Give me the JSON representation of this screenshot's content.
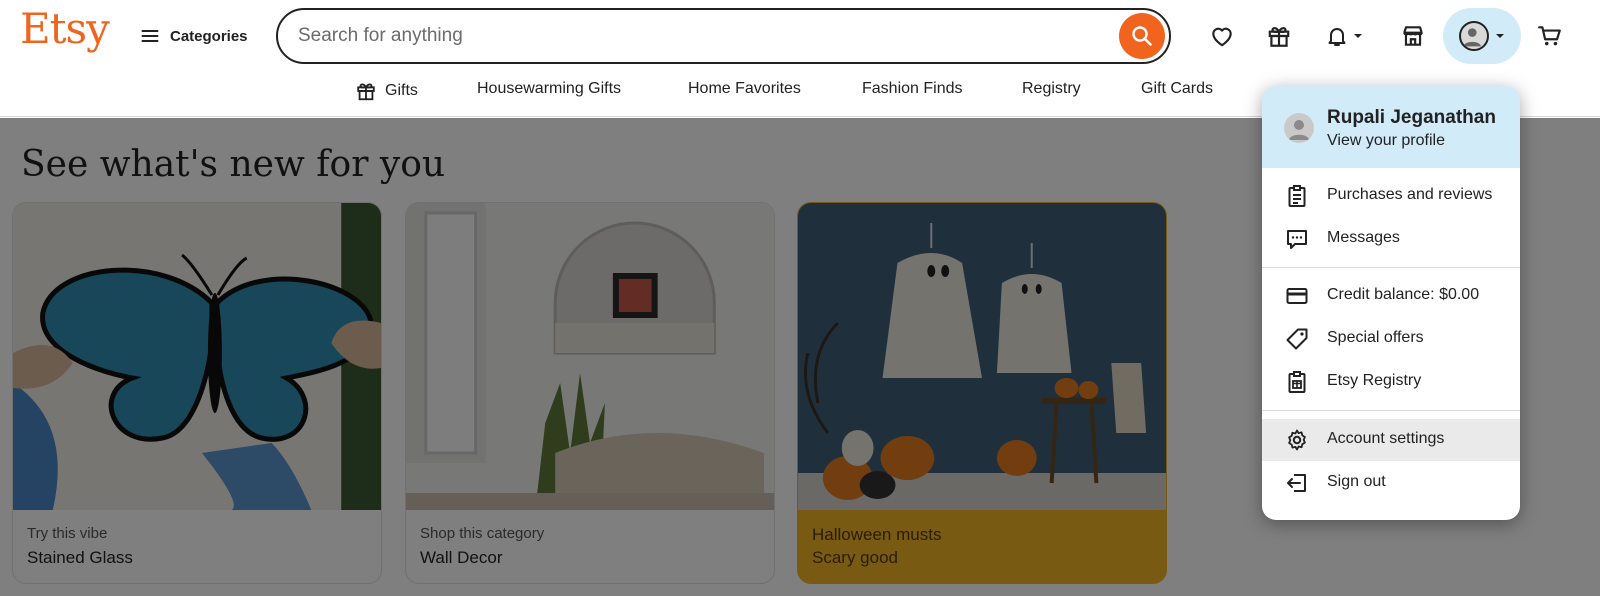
{
  "header": {
    "logo": "Etsy",
    "categories_label": "Categories",
    "search_placeholder": "Search for anything"
  },
  "subnav": [
    {
      "label": "Gifts",
      "icon": "gift-icon"
    },
    {
      "label": "Housewarming Gifts"
    },
    {
      "label": "Home Favorites"
    },
    {
      "label": "Fashion Finds"
    },
    {
      "label": "Registry"
    },
    {
      "label": "Gift Cards"
    }
  ],
  "main": {
    "section_title": "See what's new for you",
    "cards": [
      {
        "caption": "Try this vibe",
        "title": "Stained Glass"
      },
      {
        "caption": "Shop this category",
        "title": "Wall Decor"
      },
      {
        "caption": "Halloween musts",
        "title": "Scary good"
      }
    ]
  },
  "account_menu": {
    "name": "Rupali Jeganathan",
    "profile_link": "View your profile",
    "items": [
      {
        "label": "Purchases and reviews",
        "icon": "clipboard-icon"
      },
      {
        "label": "Messages",
        "icon": "message-icon"
      },
      {
        "label": "Credit balance: $0.00",
        "icon": "credit-card-icon"
      },
      {
        "label": "Special offers",
        "icon": "tag-icon"
      },
      {
        "label": "Etsy Registry",
        "icon": "registry-icon"
      },
      {
        "label": "Account settings",
        "icon": "gear-icon"
      },
      {
        "label": "Sign out",
        "icon": "sign-out-icon"
      }
    ]
  },
  "colors": {
    "brand": "#f1641e",
    "profile_bg": "#d2ebf9",
    "halloween_card": "#f1b524"
  }
}
